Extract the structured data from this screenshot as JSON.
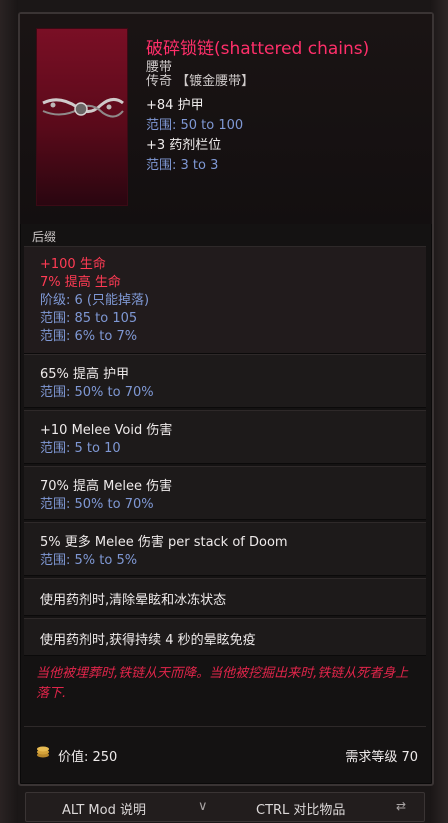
{
  "item": {
    "name": "破碎锁链(shattered chains)",
    "type": "腰带",
    "rarity": "传奇 【镀金腰带】",
    "implicits": [
      {
        "stat": "+84 护甲",
        "range": "范围: 50 to 100"
      },
      {
        "stat": "+3 药剂栏位",
        "range": "范围: 3 to 3"
      }
    ]
  },
  "affixes_label": "后缀",
  "affixes": [
    {
      "lines": [
        {
          "text": "+100 生命",
          "color": "red"
        },
        {
          "text": "7% 提高 生命",
          "color": "red"
        },
        {
          "text": "阶级: 6 (只能掉落)",
          "color": "blue"
        },
        {
          "text": "范围: 85 to 105",
          "color": "blue"
        },
        {
          "text": "范围: 6% to 7%",
          "color": "blue"
        }
      ]
    },
    {
      "lines": [
        {
          "text": "65% 提高 护甲",
          "color": "white"
        },
        {
          "text": "范围: 50% to 70%",
          "color": "blue"
        }
      ]
    },
    {
      "lines": [
        {
          "text": "+10 Melee Void 伤害",
          "color": "white"
        },
        {
          "text": "范围: 5 to 10",
          "color": "blue"
        }
      ]
    },
    {
      "lines": [
        {
          "text": "70% 提高 Melee 伤害",
          "color": "white"
        },
        {
          "text": "范围: 50% to 70%",
          "color": "blue"
        }
      ]
    },
    {
      "lines": [
        {
          "text": "5% 更多 Melee 伤害 per stack of Doom",
          "color": "white"
        },
        {
          "text": "范围: 5% to 5%",
          "color": "blue"
        }
      ]
    },
    {
      "lines": [
        {
          "text": "使用药剂时,清除晕眩和冰冻状态",
          "color": "white"
        }
      ]
    },
    {
      "lines": [
        {
          "text": "使用药剂时,获得持续 4 秒的晕眩免疫",
          "color": "white"
        }
      ]
    }
  ],
  "lore": "当他被埋葬时,铁链从天而降。当他被挖掘出来时,铁链从死者身上落下.",
  "footer": {
    "value_label": "价值: 250",
    "requirement": "需求等级 70"
  },
  "bottom_bar": {
    "alt_label": "ALT  Mod 说明",
    "alt_chevron": "∨",
    "ctrl_label": "CTRL  对比物品"
  },
  "colors": {
    "title": "#ff2f6a",
    "red": "#ff3b54",
    "blue": "#7f98d4",
    "lore": "#e0254a"
  },
  "icons": {
    "coin": "coin-stack-icon",
    "item": "chain-belt-icon",
    "compare": "compare-icon"
  }
}
